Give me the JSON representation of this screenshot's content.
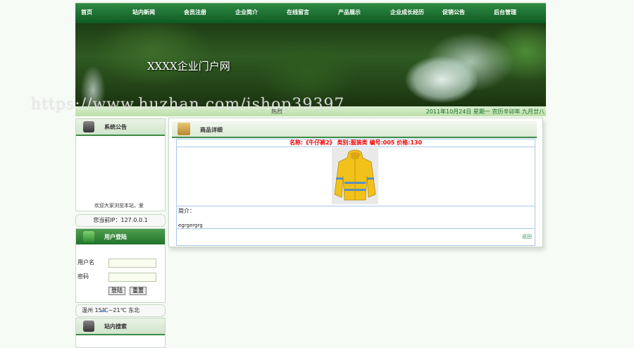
{
  "nav": [
    "首页",
    "站内新闻",
    "会员注册",
    "企业简介",
    "在线留言",
    "产品展示",
    "企业成长经历",
    "促销公告",
    "后台管理"
  ],
  "banner": {
    "title": "XXXX企业门户网",
    "left_text": "热烈",
    "date": "2011年10月24日 星期一 农历辛卯年 九月廿八"
  },
  "watermark": "https://www.huzhan.com/ishop39397",
  "sidebar": {
    "notice_title": "系统公告",
    "notice_text": "欢迎大家浏览本站，爱",
    "ip": "您当前IP：127.0.0.1",
    "login_title": "用户登陆",
    "username_label": "用户名",
    "password_label": "密码",
    "login_btn": "登陆",
    "reset_btn": "重置",
    "weather": "温州  15℃~21℃ 东北",
    "search_title": "站内搜索"
  },
  "main": {
    "title": "商品详细",
    "product_line": "名称:《牛仔裤2》 类别:服装类 编号:005 价格:130",
    "intro_label": "简介：",
    "intro_text": "egrgergrg",
    "back_label": "返回"
  },
  "colors": {
    "nav_green": "#0f5a22",
    "accent_red": "#e00000",
    "border_blue": "#a8c8e8"
  }
}
